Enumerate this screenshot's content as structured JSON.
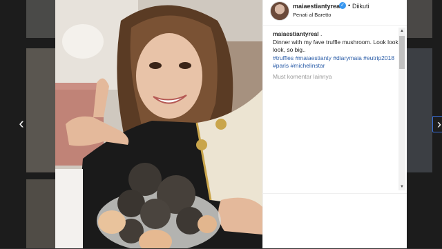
{
  "post": {
    "username": "maiaestiantyreal",
    "verified_icon": "verified-badge-icon",
    "separator": "•",
    "follow_status": "Diikuti",
    "location": "Penati al Baretto"
  },
  "caption": {
    "username": "maiaestiantyreal",
    "suffix": ".",
    "text": "Dinner with my fave truffle mushroom. Look look look, so big..",
    "hashtags": "#truffles #maiaestianty #diarymaia #eutrip2018 #paris #michelinstar",
    "more_comments": "Must komentar lainnya"
  },
  "nav": {
    "prev": "‹",
    "next": "›"
  },
  "scroll": {
    "up": "▲",
    "down": "▼"
  },
  "colors": {
    "link": "#2b5da8",
    "verified": "#3897f0",
    "text": "#262626"
  }
}
